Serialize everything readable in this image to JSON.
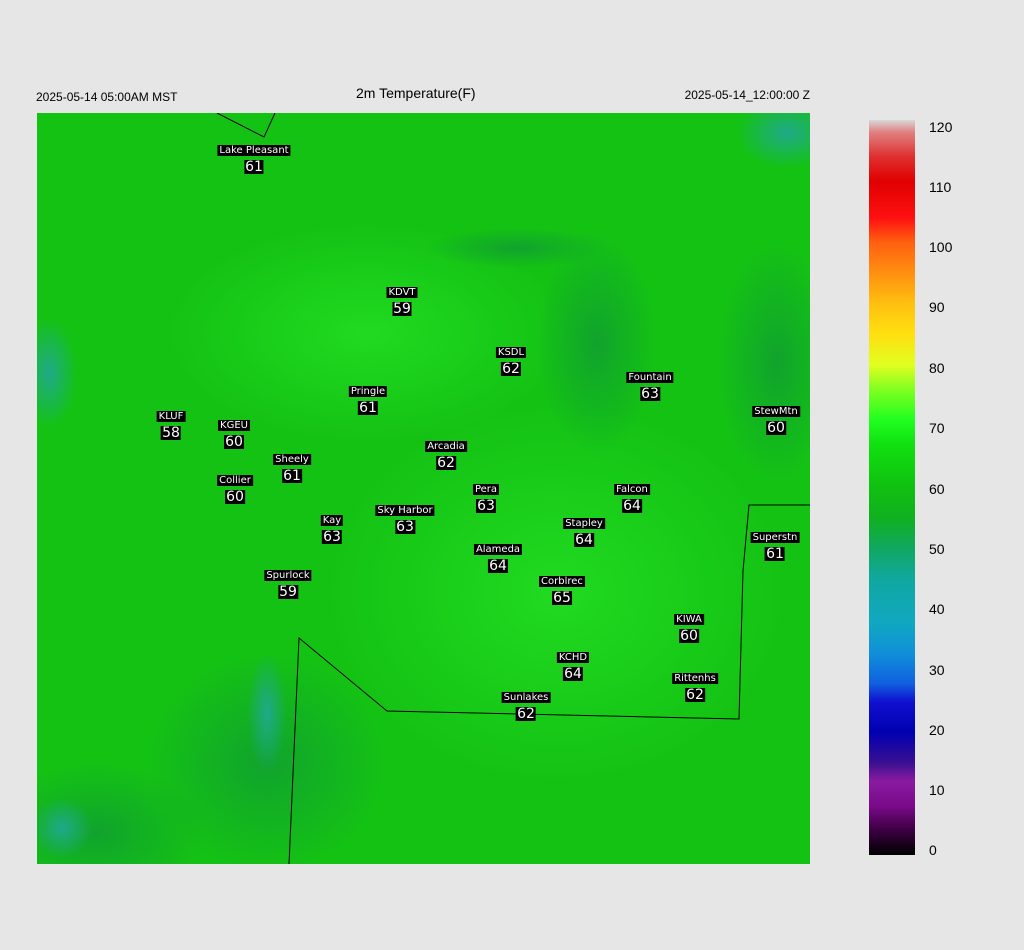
{
  "header": {
    "local_time": "2025-05-14 05:00AM MST",
    "title": "2m Temperature(F)",
    "valid_time": "2025-05-14_12:00:00 Z"
  },
  "colorbar": {
    "ticks": [
      "120",
      "110",
      "100",
      "90",
      "80",
      "70",
      "60",
      "50",
      "40",
      "30",
      "20",
      "10",
      "0"
    ],
    "min": 0,
    "max": 120
  },
  "stations": [
    {
      "name": "Lake Pleasant",
      "value": "61"
    },
    {
      "name": "KDVT",
      "value": "59"
    },
    {
      "name": "KSDL",
      "value": "62"
    },
    {
      "name": "Fountain",
      "value": "63"
    },
    {
      "name": "StewMtn",
      "value": "60"
    },
    {
      "name": "Pringle",
      "value": "61"
    },
    {
      "name": "KLUF",
      "value": "58"
    },
    {
      "name": "KGEU",
      "value": "60"
    },
    {
      "name": "Arcadia",
      "value": "62"
    },
    {
      "name": "Sheely",
      "value": "61"
    },
    {
      "name": "Collier",
      "value": "60"
    },
    {
      "name": "Pera",
      "value": "63"
    },
    {
      "name": "Falcon",
      "value": "64"
    },
    {
      "name": "Kay",
      "value": "63"
    },
    {
      "name": "Sky Harbor",
      "value": "63"
    },
    {
      "name": "Stapley",
      "value": "64"
    },
    {
      "name": "Superstn",
      "value": "61"
    },
    {
      "name": "Alameda",
      "value": "64"
    },
    {
      "name": "Spurlock",
      "value": "59"
    },
    {
      "name": "Corblrec",
      "value": "65"
    },
    {
      "name": "KIWA",
      "value": "60"
    },
    {
      "name": "KCHD",
      "value": "64"
    },
    {
      "name": "Rittenhs",
      "value": "62"
    },
    {
      "name": "Sunlakes",
      "value": "62"
    }
  ]
}
